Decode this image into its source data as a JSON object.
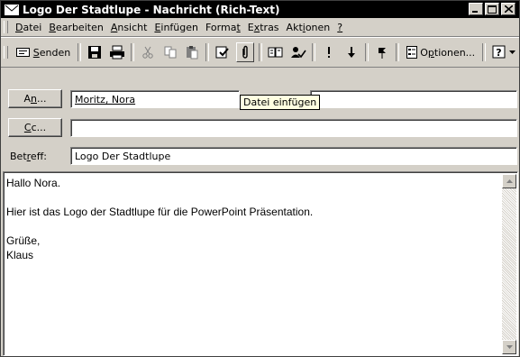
{
  "window": {
    "title": "Logo Der Stadtlupe - Nachricht (Rich-Text)"
  },
  "menu": {
    "items": [
      {
        "pre": "",
        "u": "D",
        "post": "atei"
      },
      {
        "pre": "",
        "u": "B",
        "post": "earbeiten"
      },
      {
        "pre": "",
        "u": "A",
        "post": "nsicht"
      },
      {
        "pre": "",
        "u": "E",
        "post": "infügen"
      },
      {
        "pre": "Forma",
        "u": "t",
        "post": ""
      },
      {
        "pre": "E",
        "u": "x",
        "post": "tras"
      },
      {
        "pre": "Akt",
        "u": "i",
        "post": "onen"
      },
      {
        "pre": "",
        "u": "?",
        "post": ""
      }
    ]
  },
  "toolbar": {
    "send": {
      "pre": "",
      "u": "S",
      "post": "enden"
    },
    "options": {
      "pre": "O",
      "u": "p",
      "post": "tionen..."
    },
    "tooltip": "Datei einfügen"
  },
  "header": {
    "to_button": {
      "pre": "A",
      "u": "n",
      "post": "..."
    },
    "to_value": "Moritz, Nora",
    "cc_button": {
      "pre": "",
      "u": "C",
      "post": "c..."
    },
    "cc_value": "",
    "subject_label": {
      "pre": "Bet",
      "u": "r",
      "post": "eff:"
    },
    "subject_value": "Logo Der Stadtlupe"
  },
  "message": {
    "lines": [
      "Hallo Nora.",
      "",
      "Hier ist das Logo der Stadtlupe für die PowerPoint Präsentation.",
      "",
      "Grüße,",
      "Klaus"
    ]
  }
}
